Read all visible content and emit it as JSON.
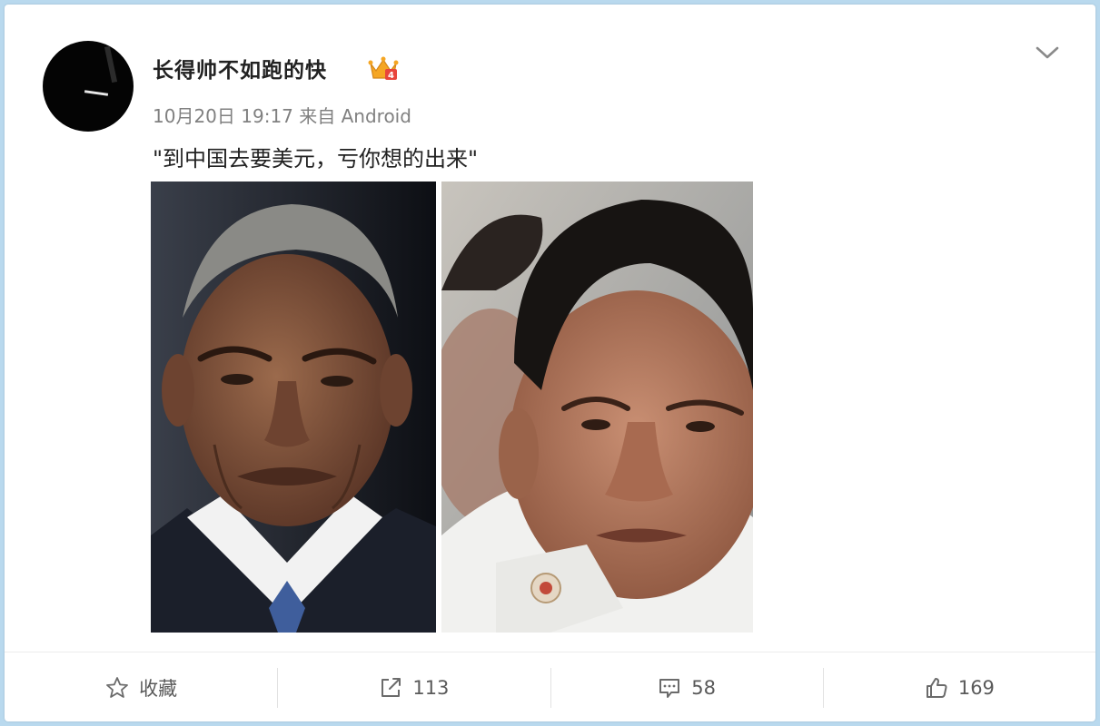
{
  "post": {
    "username": "长得帅不如跑的快",
    "meta": "10月20日 19:17 来自 Android",
    "text": "\"到中国去要美元，亏你想的出来\"",
    "images": [
      {
        "icon": "portrait-photo-left"
      },
      {
        "icon": "portrait-photo-right"
      }
    ]
  },
  "actions": {
    "favorite": {
      "label": "收藏",
      "icon": "star-icon"
    },
    "repost": {
      "label": "113",
      "icon": "share-icon"
    },
    "comment": {
      "label": "58",
      "icon": "comment-icon"
    },
    "like": {
      "label": "169",
      "icon": "thumbs-up-icon"
    }
  },
  "colors": {
    "page_background": "#b9d9ee",
    "card_background": "#ffffff",
    "meta_text": "#808080",
    "primary_text": "#222222",
    "vip_badge": "#f5a623"
  }
}
